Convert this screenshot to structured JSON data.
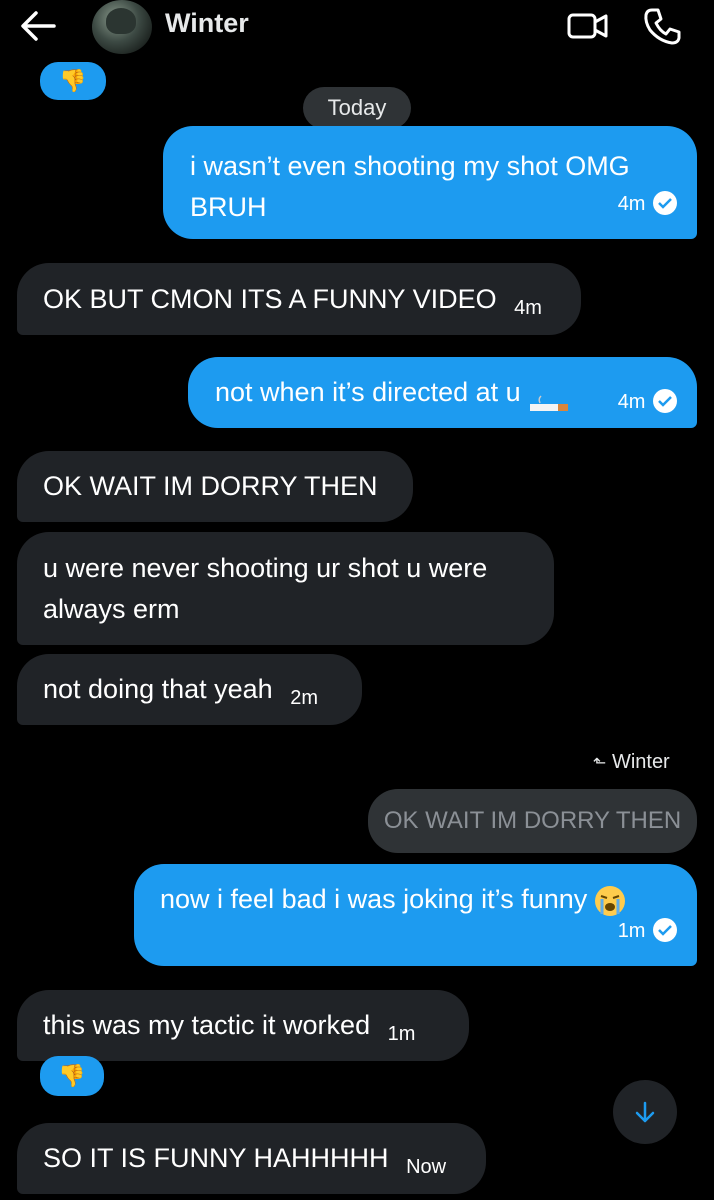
{
  "header": {
    "contact_name": "Winter",
    "icons": [
      "back-arrow-icon",
      "avatar",
      "video-call-icon",
      "phone-call-icon"
    ]
  },
  "date_separator": "Today",
  "reactions": [
    "👎",
    "👎"
  ],
  "messages": [
    {
      "from": "me",
      "text_line1": "i wasn’t even shooting my shot OMG",
      "text_line2": "BRUH",
      "time": "4m",
      "read": true
    },
    {
      "from": "them",
      "text": "OK BUT CMON ITS A FUNNY VIDEO",
      "time": "4m"
    },
    {
      "from": "me",
      "text": "not when it’s directed at u",
      "emoji": "🚬",
      "time": "4m",
      "read": true
    },
    {
      "from": "them",
      "text": "OK WAIT IM DORRY THEN"
    },
    {
      "from": "them",
      "text_line1": "u were never shooting ur shot u were",
      "text_line2": "always erm"
    },
    {
      "from": "them",
      "text": "not doing that yeah",
      "time": "2m"
    },
    {
      "from": "me",
      "reply_to_name": "Winter",
      "quoted_text": "OK WAIT IM DORRY THEN",
      "text": "now i feel bad i was joking it’s funny",
      "emoji": "😭",
      "time": "1m",
      "read": true
    },
    {
      "from": "them",
      "text": "this was my tactic it worked",
      "time": "1m"
    },
    {
      "from": "them",
      "text": "SO IT IS FUNNY HAHHHHH",
      "time": "Now"
    }
  ],
  "colors": {
    "my_bubble": "#1d9bf0",
    "their_bubble": "#202327",
    "background": "#000000"
  }
}
